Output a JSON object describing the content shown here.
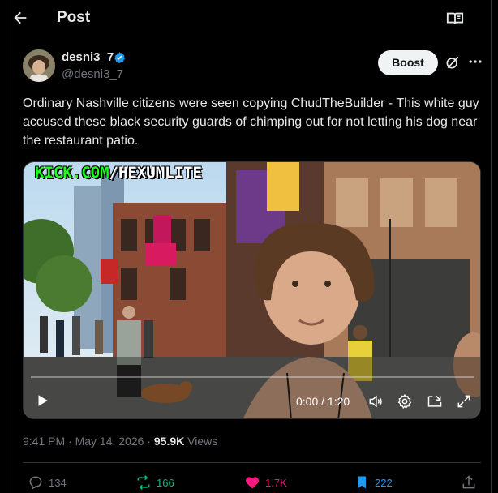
{
  "header": {
    "title": "Post",
    "back_icon": "arrow-left-icon",
    "reader_icon": "reader-mode-icon"
  },
  "author": {
    "display_name": "desni3_7",
    "handle": "@desni3_7",
    "verified": true
  },
  "actions_top": {
    "boost_label": "Boost",
    "grok_icon": "grok-icon",
    "more_icon": "more-icon"
  },
  "tweet": {
    "text": "Ordinary Nashville citizens were seen copying ChudTheBuilder - This white guy accused these black security guards of chimping out for not letting his dog near the restaurant patio."
  },
  "video": {
    "watermark_green": "KICK.COM",
    "watermark_white": "/HEXUMLITE",
    "time": "0:00 / 1:20",
    "progress": 0.0
  },
  "meta": {
    "timestamp": "9:41 PM · May 14, 2026",
    "separator": " · ",
    "views_count": "95.9K",
    "views_label": " Views"
  },
  "engagement": {
    "replies": "134",
    "reposts": "166",
    "likes": "1.7K",
    "bookmarks": "222"
  },
  "colors": {
    "accent": "#1d9bf0",
    "repost": "#00ba7c",
    "like": "#f91880",
    "muted": "#71767b"
  }
}
